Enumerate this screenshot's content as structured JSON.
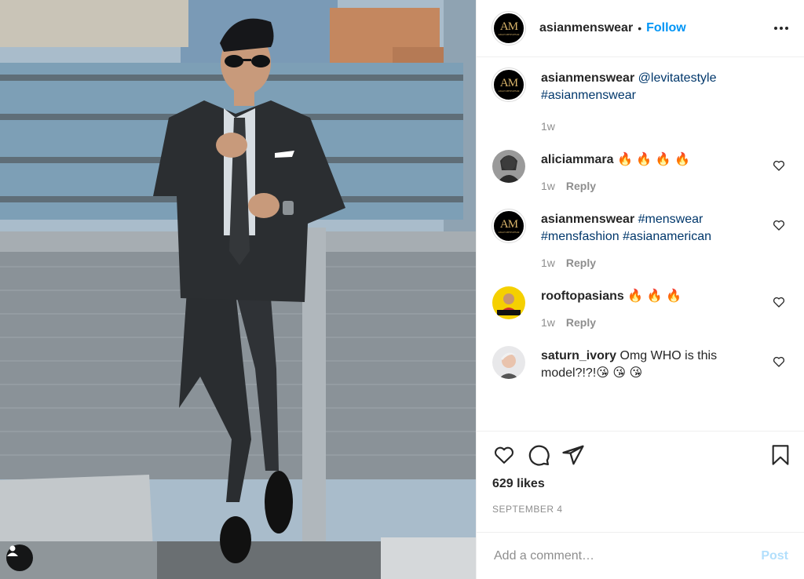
{
  "header": {
    "username": "asianmenswear",
    "separator": "•",
    "follow_label": "Follow"
  },
  "brand_avatar": {
    "mark": "AM",
    "subtitle": "ASIAN MENSWEAR"
  },
  "caption": {
    "username": "asianmenswear",
    "mention": "@levitatestyle",
    "hashtag": "#asianmenswear",
    "time": "1w"
  },
  "comments": [
    {
      "username": "aliciammara",
      "text": "🔥 🔥 🔥 🔥",
      "time": "1w",
      "reply": "Reply"
    },
    {
      "username": "asianmenswear",
      "text": "#menswear #mensfashion #asianamerican",
      "time": "1w",
      "reply": "Reply"
    },
    {
      "username": "rooftopasians",
      "text": "🔥 🔥 🔥",
      "time": "1w",
      "reply": "Reply"
    },
    {
      "username": "saturn_ivory",
      "text": "Omg WHO is this model?!?!😘 😘 😘"
    }
  ],
  "actions": {
    "likes": "629 likes",
    "date": "SEPTEMBER 4"
  },
  "add_comment": {
    "placeholder": "Add a comment…",
    "post_label": "Post"
  },
  "colors": {
    "accent": "#0095f6",
    "link": "#00376b",
    "muted": "#8e8e8e",
    "post_disabled": "#b2dffc"
  },
  "icons": [
    "user-tag-icon",
    "more-options-icon",
    "heart-icon",
    "comment-icon",
    "share-icon",
    "save-icon"
  ]
}
